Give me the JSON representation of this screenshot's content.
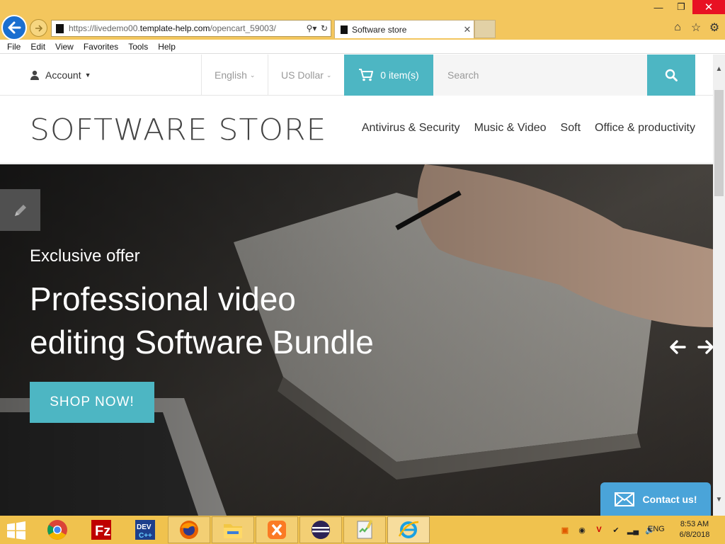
{
  "browser": {
    "url_prefix": "https://livedemo00.",
    "url_host": "template-help.com",
    "url_path": "/opencart_59003/",
    "tab_title": "Software store",
    "menu": [
      "File",
      "Edit",
      "View",
      "Favorites",
      "Tools",
      "Help"
    ]
  },
  "topbar": {
    "account_label": "Account",
    "language": "English",
    "currency": "US Dollar",
    "cart_label": "0 item(s)",
    "search_placeholder": "Search"
  },
  "header": {
    "logo": "SOFTWARE STORE",
    "nav": [
      "Antivirus & Security",
      "Music & Video",
      "Soft",
      "Office & productivity"
    ]
  },
  "hero": {
    "kicker": "Exclusive offer",
    "title_line1": "Professional video",
    "title_line2": "editing Software Bundle",
    "cta": "SHOP NOW!"
  },
  "contact": {
    "label": "Contact us!"
  },
  "taskbar": {
    "language": "ENG",
    "time": "8:53 AM",
    "date": "6/8/2018",
    "apps": [
      "chrome-icon",
      "filezilla-icon",
      "devcpp-icon",
      "firefox-icon",
      "file-explorer-icon",
      "xampp-icon",
      "eclipse-icon",
      "notepadpp-icon",
      "internet-explorer-icon"
    ]
  },
  "colors": {
    "accent": "#4db6c3",
    "chrome_bar": "#f3c65d",
    "contact": "#4aa4d9"
  }
}
